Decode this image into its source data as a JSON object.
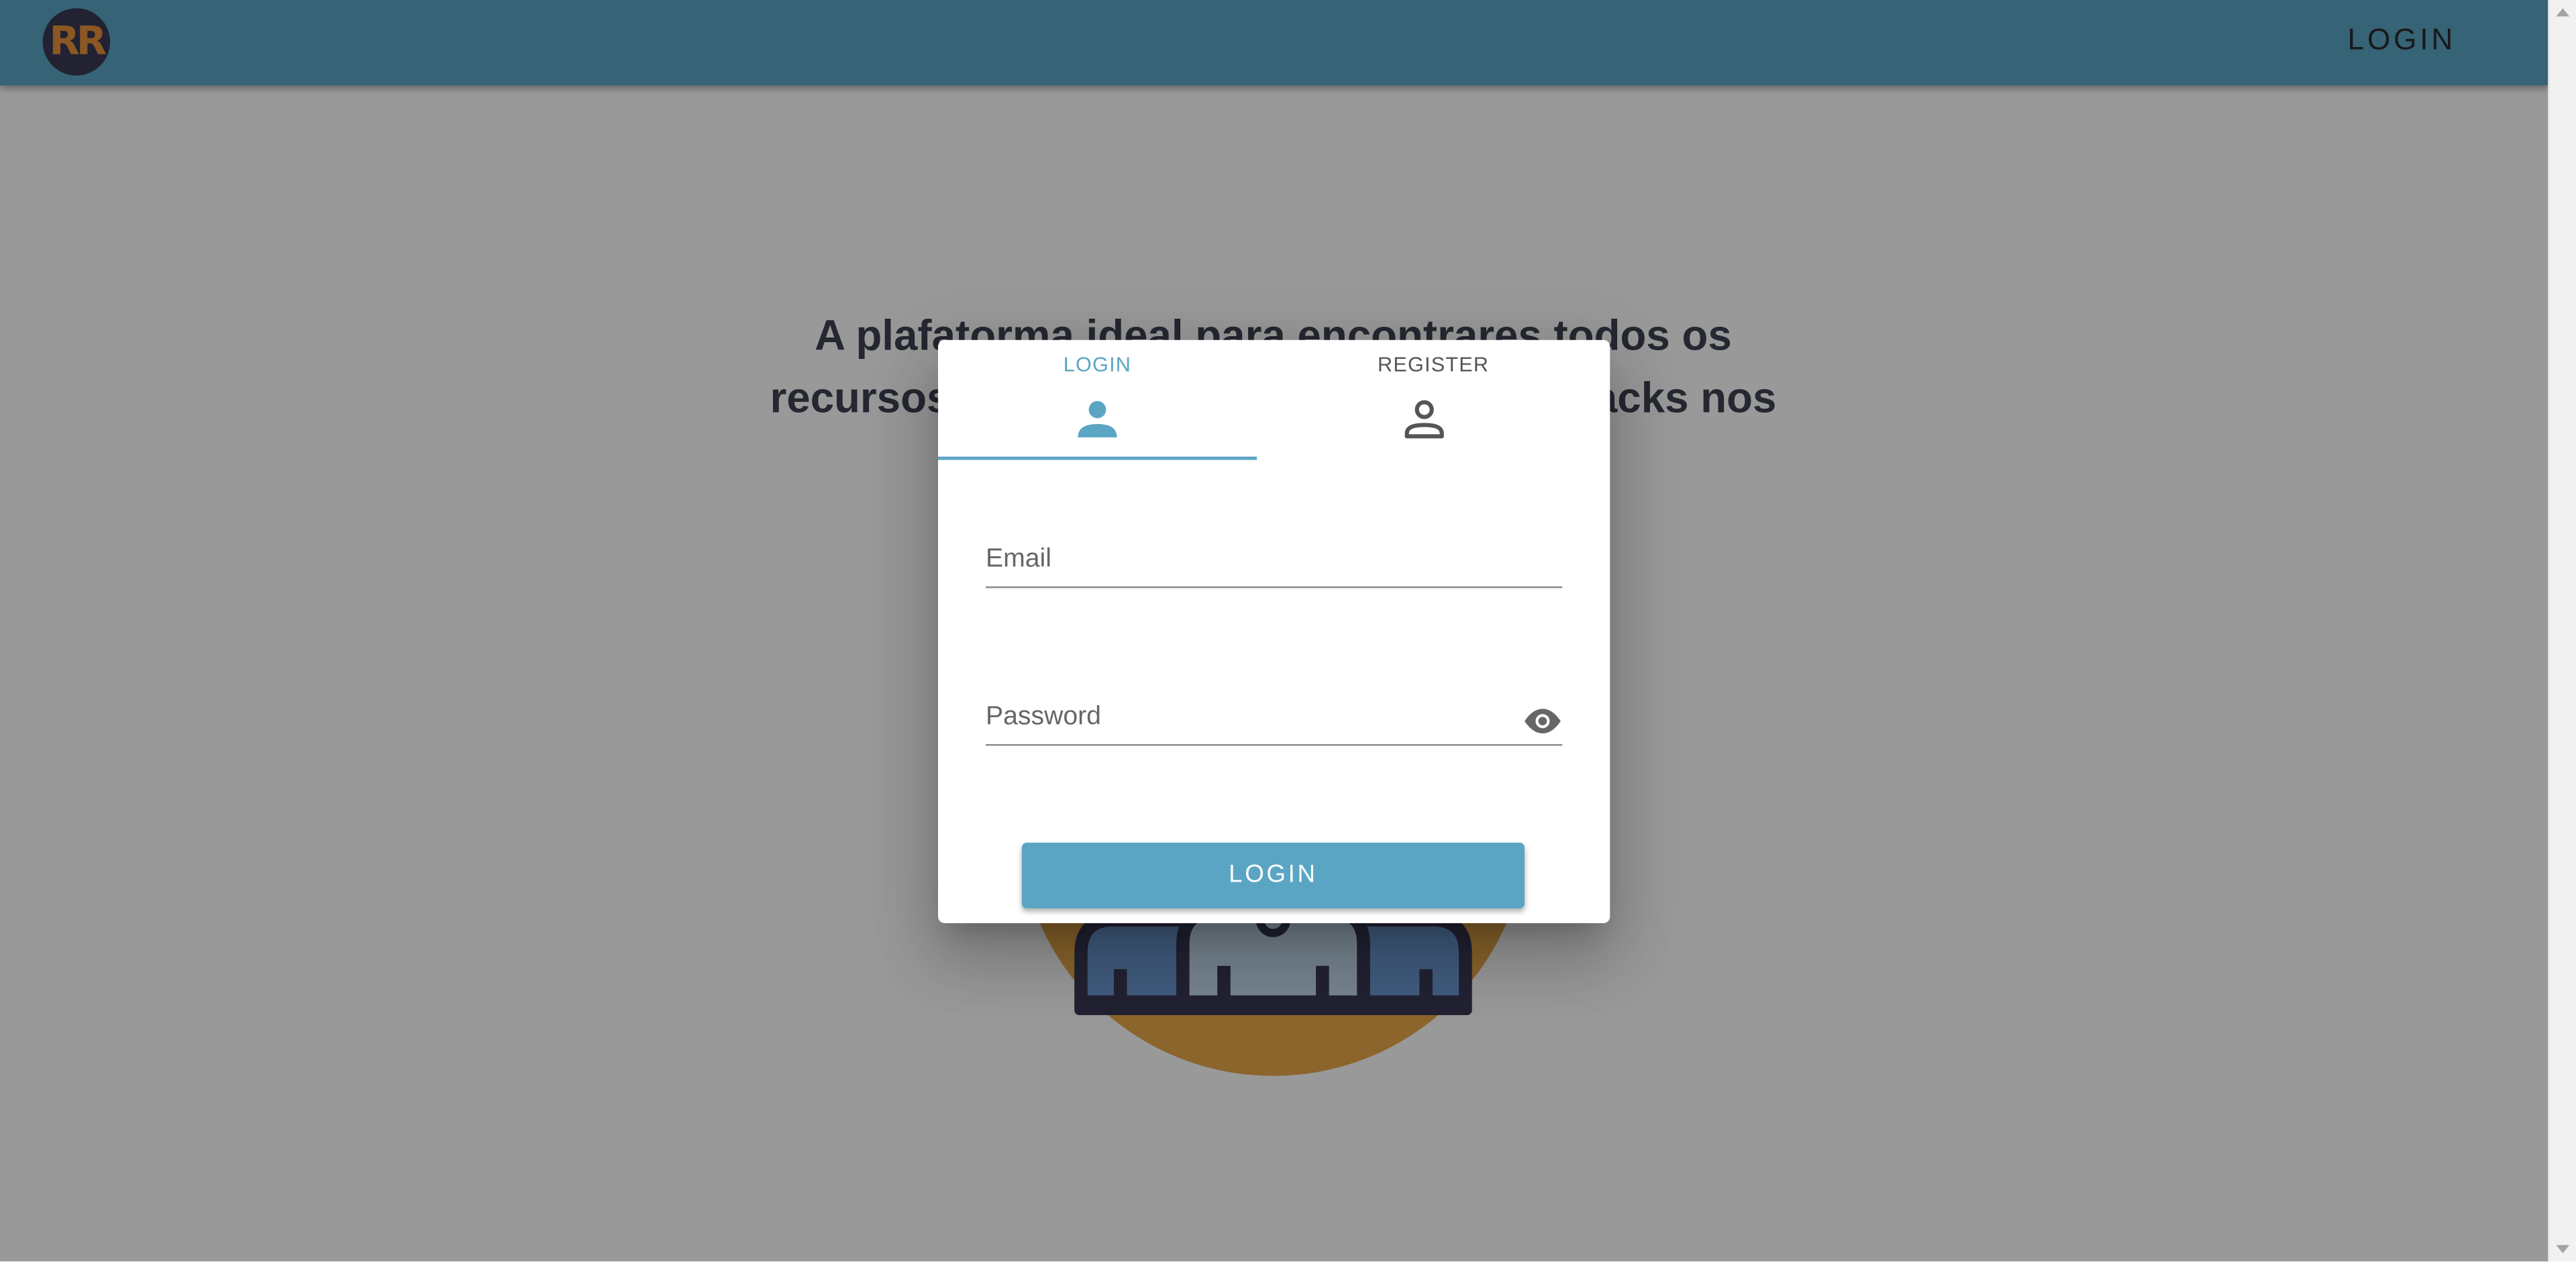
{
  "header": {
    "logo_text": "RR",
    "nav_login": "LOGIN"
  },
  "hero": {
    "line1": "A plafatorma ideal para encontrares todos os",
    "line2": "recursos                                                    packs nos"
  },
  "dialog": {
    "tabs": [
      {
        "label": "LOGIN",
        "icon": "person-filled-icon",
        "active": true
      },
      {
        "label": "REGISTER",
        "icon": "person-outline-icon",
        "active": false
      }
    ],
    "email": {
      "label": "Email",
      "value": ""
    },
    "password": {
      "label": "Password",
      "value": "",
      "toggle_icon": "eye-icon"
    },
    "submit_label": "LOGIN"
  },
  "colors": {
    "accent": "#5aa5c4",
    "logo_bg": "#3a3a56",
    "logo_fg": "#e8913a",
    "overlay": "rgba(0,0,0,0.4)"
  }
}
